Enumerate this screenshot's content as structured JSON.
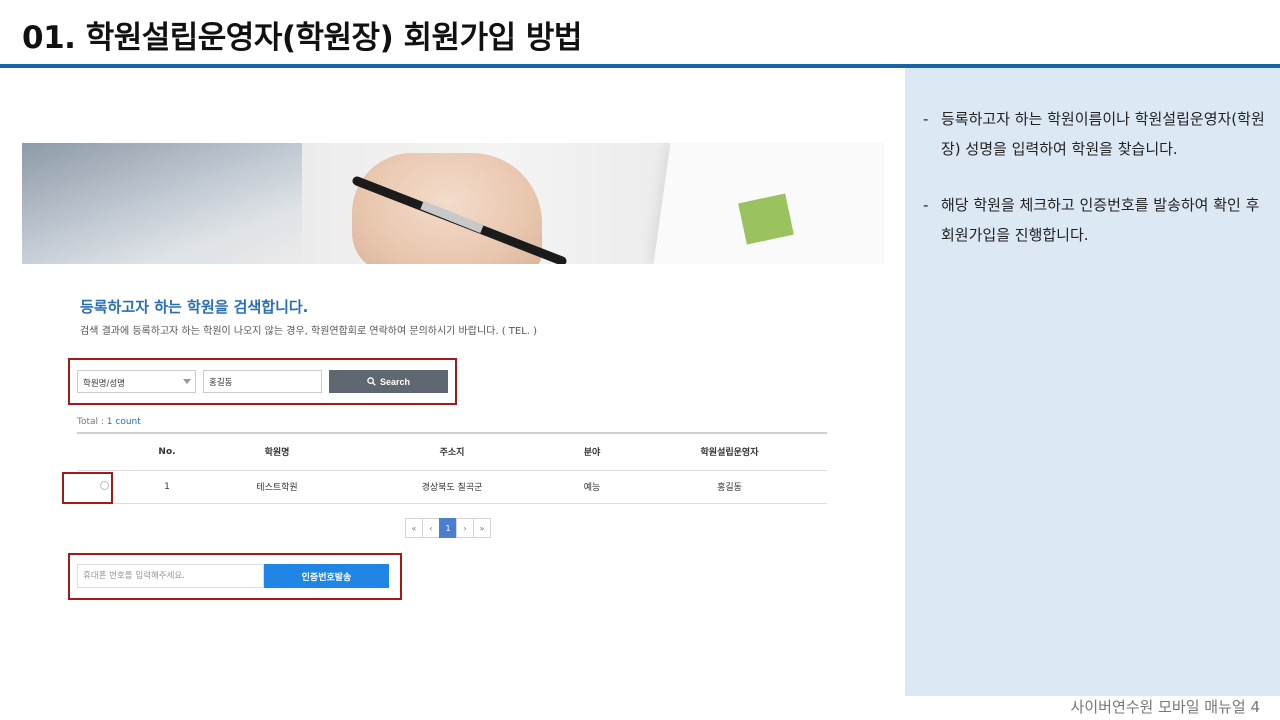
{
  "slide": {
    "title": "01. 학원설립운영자(학원장) 회원가입 방법",
    "footer": "사이버연수원 모바일 매뉴얼  4",
    "accent_color": "#1565a6",
    "panel_color": "#dde8f5",
    "highlight_color": "#a11b1b"
  },
  "notes": [
    {
      "dash": "-",
      "text": "등록하고자 하는 학원이름이나 학원설립운영자(학원장) 성명을 입력하여 학원을 찾습니다."
    },
    {
      "dash": "-",
      "text": "해당 학원을 체크하고 인증번호를 발송하여 확인 후 회원가입을 진행합니다."
    }
  ],
  "search": {
    "heading": "등록하고자 하는 학원을 검색합니다.",
    "description": "검색 결과에 등록하고자 하는 학원이 나오지 않는 경우, 학원연합회로 연락하여 문의하시기 바랍니다. ( TEL. )",
    "select_value": "학원명/성명",
    "input_value": "홍길동",
    "button_label": "Search",
    "button_icon": "search-icon"
  },
  "results": {
    "total_label": "Total :",
    "total_count": "1 count",
    "headers": [
      "",
      "No.",
      "학원명",
      "주소지",
      "분야",
      "학원설립운영자"
    ],
    "rows": [
      {
        "no": "1",
        "name": "테스트학원",
        "address": "경상북도 칠곡군",
        "field": "예능",
        "owner": "홍길동"
      }
    ]
  },
  "pagination": {
    "first": "«",
    "prev": "‹",
    "current": "1",
    "next": "›",
    "last": "»"
  },
  "auth": {
    "phone_placeholder": "휴대폰 번호를 입력해주세요.",
    "button_label": "인증번호발송"
  }
}
